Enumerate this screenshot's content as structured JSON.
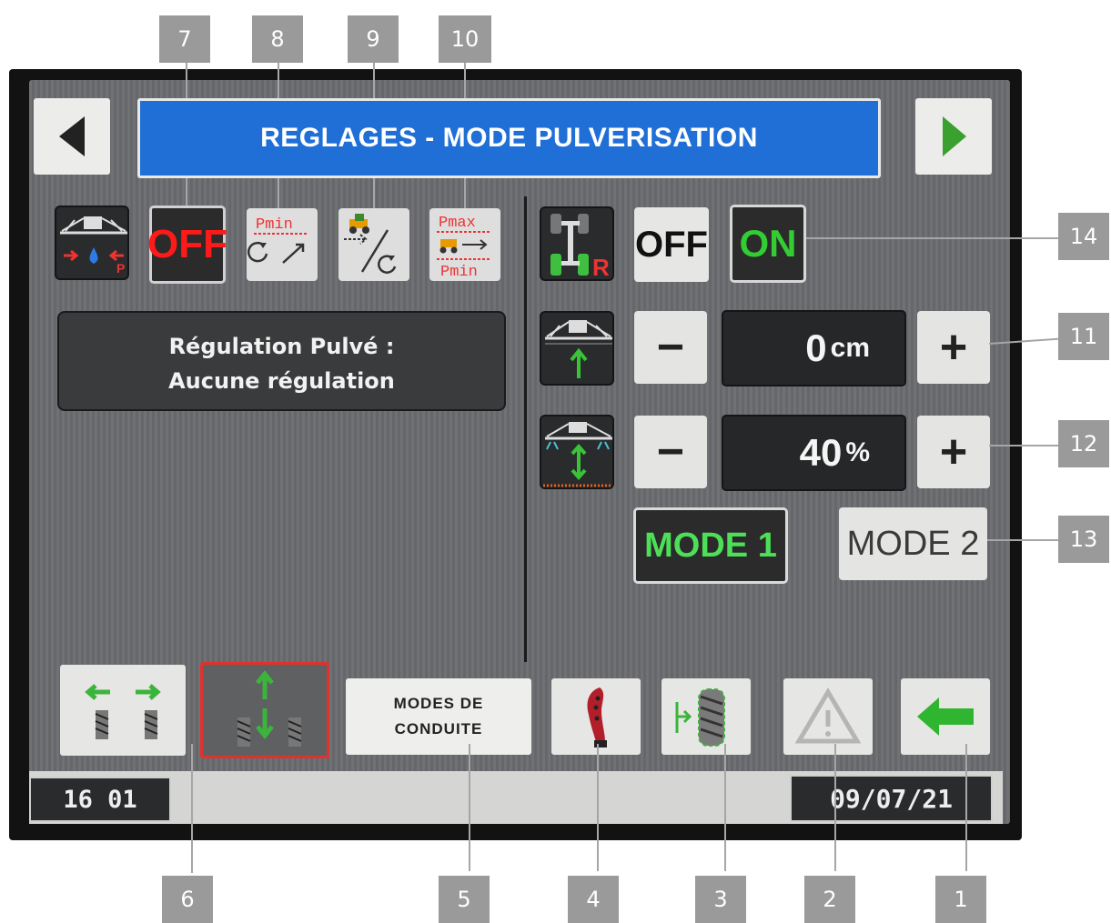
{
  "title_bar": {
    "text": "REGLAGES - MODE PULVERISATION"
  },
  "top_row": {
    "off_red_label": "OFF",
    "pmin_label": "Pmin",
    "pmax_label": "Pmax",
    "pmin_bottom_label": "Pmin",
    "suspension_off_label": "OFF",
    "suspension_on_label": "ON",
    "suspension_icon_letter": "R"
  },
  "regulation": {
    "line1": "Régulation Pulvé :",
    "line2": "Aucune régulation"
  },
  "height_setting": {
    "minus": "−",
    "value": "0",
    "unit": "cm",
    "plus": "+"
  },
  "percent_setting": {
    "minus": "−",
    "value": "40",
    "unit": "%",
    "plus": "+"
  },
  "modes": {
    "mode1": "MODE 1",
    "mode2": "MODE 2"
  },
  "bottom": {
    "modes_line1": "MODES DE",
    "modes_line2": "CONDUITE"
  },
  "status": {
    "left": "16 01",
    "right": "09/07/21"
  },
  "callouts": {
    "c1": "1",
    "c2": "2",
    "c3": "3",
    "c4": "4",
    "c5": "5",
    "c6": "6",
    "c7": "7",
    "c8": "8",
    "c9": "9",
    "c10": "10",
    "c11": "11",
    "c12": "12",
    "c13": "13",
    "c14": "14"
  },
  "colors": {
    "title_blue": "#1f6fd6",
    "off_red": "#ff1a1a",
    "on_green": "#33cc33",
    "mode1_green": "#4ddf57",
    "selected_border_red": "#e0322d",
    "arrow_green": "#2fb52f"
  },
  "icons": {
    "nav_left": "triangle-left-icon",
    "nav_right": "triangle-right-icon",
    "back": "arrow-left-icon",
    "warning": "warning-triangle-icon",
    "joystick": "joystick-icon",
    "tyre": "tyre-guidance-icon",
    "track_width": "track-width-icon",
    "steering_mode": "steering-mode-icon"
  }
}
